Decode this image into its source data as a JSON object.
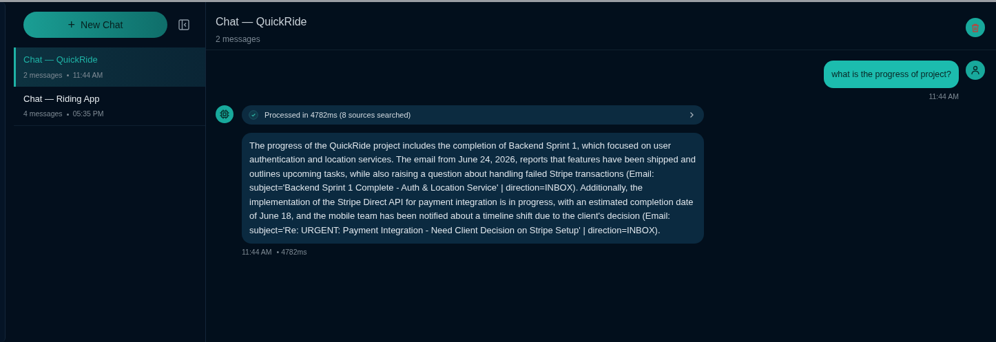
{
  "sidebar": {
    "new_chat_label": "New Chat",
    "new_chat_icon": "+",
    "chats": [
      {
        "title": "Chat — QuickRide",
        "count": "2 messages",
        "time": "11:44 AM",
        "selected": true
      },
      {
        "title": "Chat — Riding App",
        "count": "4 messages",
        "time": "05:35 PM",
        "selected": false
      }
    ]
  },
  "header": {
    "title": "Chat — QuickRide",
    "subtitle": "2 messages"
  },
  "messages": [
    {
      "kind": "user",
      "text": "what is the progress of project?",
      "time": "11:44 AM"
    },
    {
      "kind": "assistant",
      "status": "Processed in 4782ms (8 sources searched)",
      "text": "The progress of the QuickRide project includes the completion of Backend Sprint 1, which focused on user authentication and location services. The email from June 24, 2026, reports that features have been shipped and outlines upcoming tasks, while also raising a question about handling failed Stripe transactions (Email: subject='Backend Sprint 1 Complete - Auth & Location Service' | direction=INBOX). Additionally, the implementation of the Stripe Direct API for payment integration is in progress, with an estimated completion date of June 18, and the mobile team has been notified about a timeline shift due to the client's decision (Email: subject='Re: URGENT: Payment Integration - Need Client Decision on Stripe Setup' | direction=INBOX).",
      "time": "11:44 AM",
      "duration": "• 4782ms"
    }
  ]
}
